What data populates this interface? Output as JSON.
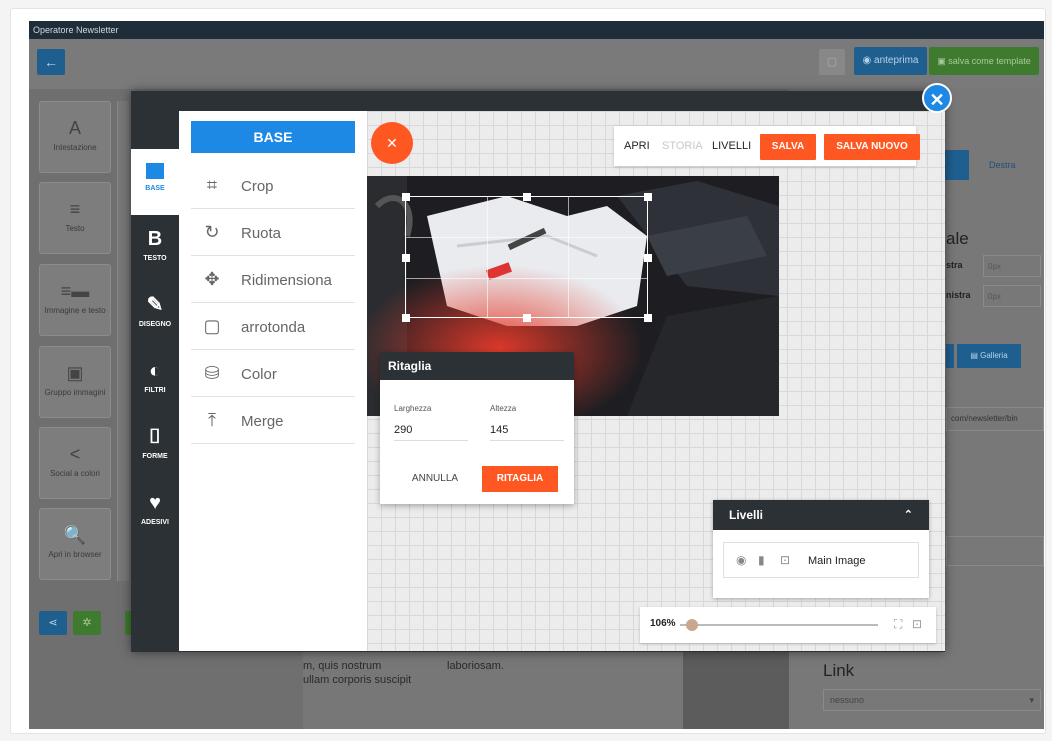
{
  "app": {
    "title": "Operatore Newsletter",
    "back_icon": "arrow-left-icon",
    "preview_label": "anteprima",
    "save_template_label": "salva come template"
  },
  "sidebar_blocks": [
    {
      "label": "Intestazione",
      "icon": "A"
    },
    {
      "label": "Testo",
      "icon": "≡"
    },
    {
      "label": "Immagine e testo",
      "icon": "≡▬"
    },
    {
      "label": "Gruppo immagini",
      "icon": "▣"
    },
    {
      "label": "Social a colori",
      "icon": "<"
    },
    {
      "label": "Apri in browser",
      "icon": "🔍"
    }
  ],
  "background_panel": {
    "right_tab": "Destra",
    "heading": "ale",
    "field1_label": "stra",
    "field1_value": "0px",
    "field2_label": "nistra",
    "field2_value": "0px",
    "gallery_label": "Galleria",
    "url_text": "com/newsletter/bin",
    "link_heading": "Link",
    "link_select": "nessuno",
    "text_col1_line1": "m, quis nostrum",
    "text_col1_line2": "ullam corporis suscipit",
    "text_col2_line1": "laboriosam."
  },
  "editor": {
    "nav": [
      {
        "label": "BASE",
        "icon": "image-icon",
        "glyph": "▲",
        "active": true
      },
      {
        "label": "TESTO",
        "icon": "bold-icon",
        "glyph": "B",
        "active": false
      },
      {
        "label": "DISEGNO",
        "icon": "brush-icon",
        "glyph": "✎",
        "active": false
      },
      {
        "label": "FILTRI",
        "icon": "filter-icon",
        "glyph": "◐",
        "active": false
      },
      {
        "label": "FORME",
        "icon": "shape-icon",
        "glyph": "⌷",
        "active": false
      },
      {
        "label": "ADESIVI",
        "icon": "heart-icon",
        "glyph": "♥",
        "active": false
      }
    ],
    "panel_title": "BASE",
    "tools": [
      {
        "label": "Crop",
        "icon": "crop-icon",
        "glyph": "⌗"
      },
      {
        "label": "Ruota",
        "icon": "rotate-icon",
        "glyph": "↻"
      },
      {
        "label": "Ridimensiona",
        "icon": "resize-icon",
        "glyph": "✥"
      },
      {
        "label": "arrotonda",
        "icon": "round-corner-icon",
        "glyph": "▢"
      },
      {
        "label": "Color",
        "icon": "paint-bucket-icon",
        "glyph": "⛁"
      },
      {
        "label": "Merge",
        "icon": "merge-icon",
        "glyph": "⤒"
      }
    ],
    "topmenu": {
      "apri": "APRI",
      "storia": "STORIA",
      "livelli": "LIVELLI",
      "salva": "SALVA",
      "salva_nuovo": "SALVA NUOVO"
    },
    "crop": {
      "title": "Ritaglia",
      "width_label": "Larghezza",
      "width_value": "290",
      "height_label": "Altezza",
      "height_value": "145",
      "cancel_label": "ANNULLA",
      "confirm_label": "RITAGLIA"
    },
    "layers": {
      "title": "Livelli",
      "items": [
        {
          "name": "Main Image"
        }
      ]
    },
    "zoom": {
      "label": "106%",
      "value": 0.06
    }
  },
  "colors": {
    "accent_blue": "#1e88e5",
    "accent_orange": "#ff5722",
    "dark": "#2c3136"
  }
}
